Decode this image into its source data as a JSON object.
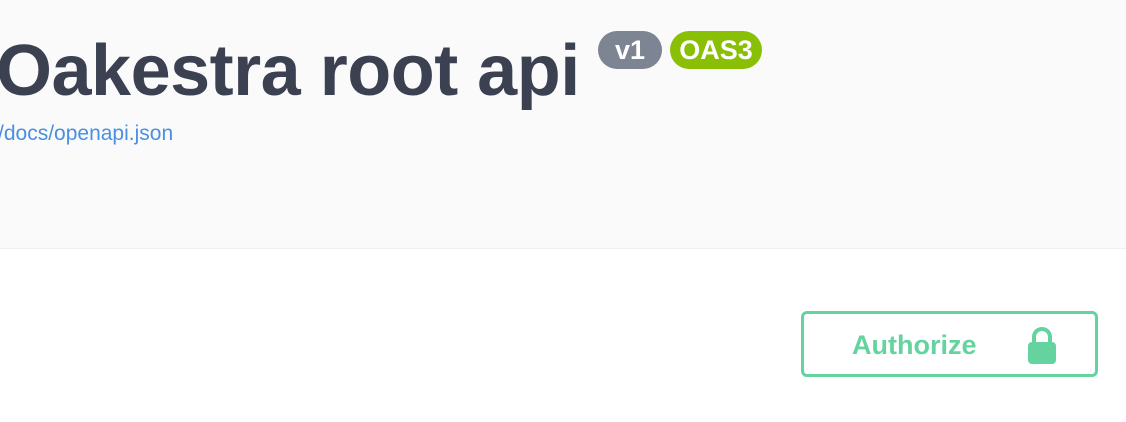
{
  "info": {
    "title": "Oakestra root api",
    "version_badge": "v1",
    "oas_badge": "OAS3",
    "spec_link": "/docs/openapi.json"
  },
  "auth": {
    "button_label": "Authorize",
    "icon": "lock-icon"
  },
  "colors": {
    "title": "#3b4151",
    "version_badge_bg": "#7d8492",
    "oas_badge_bg": "#89bf04",
    "link": "#4990e2",
    "authorize_accent": "#49cc90",
    "info_bg": "#fafafa"
  }
}
